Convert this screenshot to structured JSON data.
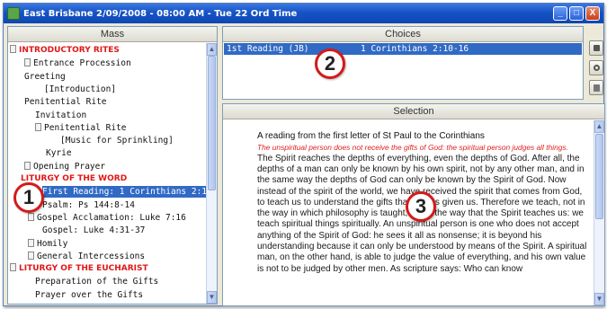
{
  "window": {
    "title": "East Brisbane 2/09/2008 - 08:00 AM - Tue 22 Ord Time",
    "minimize_glyph": "_",
    "maximize_glyph": "□",
    "close_glyph": "X"
  },
  "mass": {
    "header": "Mass",
    "items": [
      {
        "label": "INTRODUCTORY RITES",
        "kind": "section"
      },
      {
        "label": "Entrance Procession"
      },
      {
        "label": "Greeting"
      },
      {
        "label": "[Introduction]"
      },
      {
        "label": "Penitential Rite"
      },
      {
        "label": "Invitation"
      },
      {
        "label": "Penitential Rite"
      },
      {
        "label": "[Music for Sprinkling]"
      },
      {
        "label": "Kyrie"
      },
      {
        "label": "Opening Prayer"
      },
      {
        "label": "LITURGY OF THE WORD",
        "kind": "section"
      },
      {
        "label": "First Reading: 1 Corinthians 2:1",
        "selected": true
      },
      {
        "label": "Psalm: Ps 144:8-14"
      },
      {
        "label": "Gospel Acclamation: Luke 7:16"
      },
      {
        "label": "Gospel: Luke 4:31-37"
      },
      {
        "label": "Homily"
      },
      {
        "label": "General Intercessions"
      },
      {
        "label": "LITURGY OF THE EUCHARIST",
        "kind": "section"
      },
      {
        "label": "Preparation of the Gifts"
      },
      {
        "label": "Prayer over the Gifts"
      }
    ]
  },
  "choices": {
    "header": "Choices",
    "selected_row": {
      "reading": "1st Reading (JB)",
      "reference": "1 Corinthians 2:10-16"
    },
    "tool_icons": [
      "stop-icon",
      "refresh-icon",
      "document-icon"
    ]
  },
  "selection": {
    "header": "Selection",
    "heading": "A reading from the first letter of St Paul to the Corinthians",
    "summary": "The unspiritual person does not receive the gifts of God: the spiritual person judges all things.",
    "body": "The Spirit reaches the depths of everything, even the depths of God. After all, the depths of a man can only be known by his own spirit, not by any other man, and in the same way the depths of God can only be known by the Spirit of God. Now instead of the spirit of the world, we have received the spirit that comes from God, to teach us to understand the gifts that he has given us. Therefore we teach, not in the way in which philosophy is taught, but in the way that the Spirit teaches us: we teach spiritual things spiritually. An unspiritual person is one who does not accept anything of the Spirit of God: he sees it all as nonsense; it is beyond his understanding because it can only be understood by means of the Spirit. A spiritual man, on the other hand, is able to judge the value of everything, and his own value is not to be judged by other men. As scripture says: Who can know"
  },
  "callouts": [
    "1",
    "2",
    "3"
  ],
  "colors": {
    "section": "#e01818",
    "selection": "#316ac5",
    "callout_ring": "#d41a1a"
  }
}
